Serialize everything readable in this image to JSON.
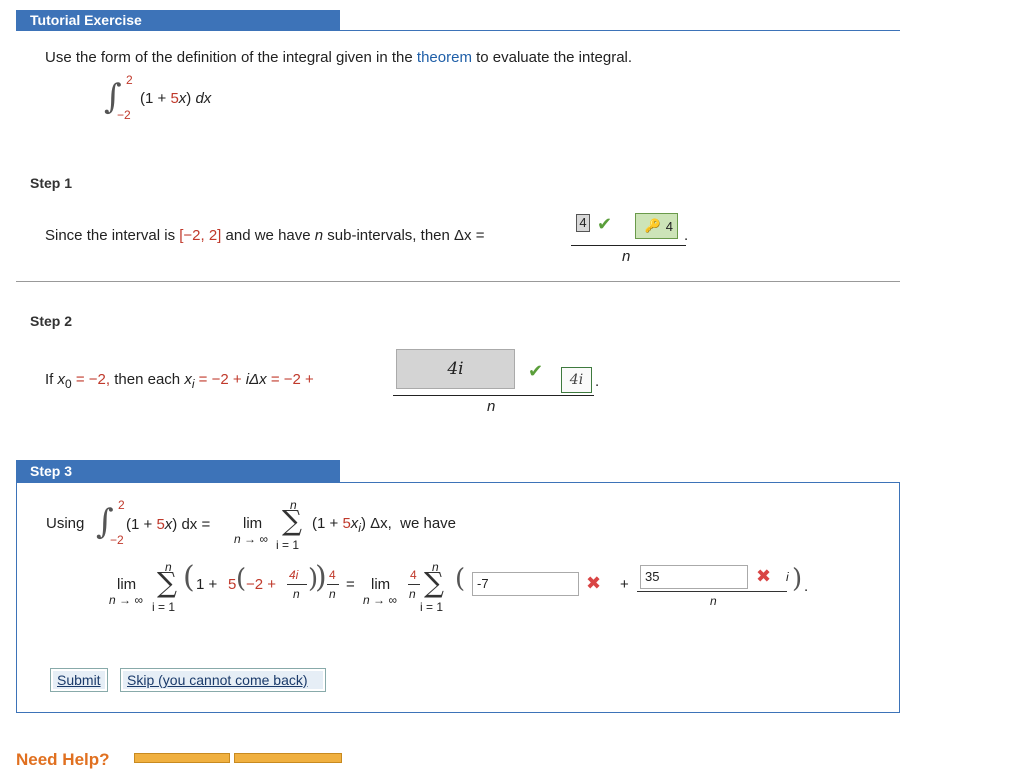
{
  "header": {
    "title": "Tutorial Exercise"
  },
  "problem": {
    "text_before_link": "Use the form of the definition of the integral given in the",
    "link_text": "theorem",
    "text_after_link": "to evaluate the integral.",
    "integral": {
      "upper": "2",
      "lower": "−2",
      "integrand_open": "(1 + ",
      "coef": "5",
      "var": "x",
      "integrand_close": ")",
      "dx": "dx"
    }
  },
  "step1": {
    "label": "Step 1",
    "text_a": "Since the interval is ",
    "interval": "[−2, 2]",
    "text_b": " and we have ",
    "n": "n",
    "text_c": " sub-intervals, then ",
    "delta_x": "Δx =",
    "answer": "4",
    "key_value": "4",
    "denominator": "n",
    "period": "."
  },
  "step2": {
    "label": "Step 2",
    "text_if": "If ",
    "x0": "x",
    "x0_sub": "0",
    "eq1": " = −2,",
    "text_then": " then each ",
    "xi": "x",
    "xi_sub": "i",
    "eq2": " = −2 + ",
    "i_delta": "iΔx",
    "eq3": " = −2 + ",
    "answer": "4i",
    "key_value": "4i",
    "denominator": "n",
    "period": "."
  },
  "step3": {
    "label": "Step 3",
    "using": "Using",
    "integral": {
      "upper": "2",
      "lower": "−2",
      "body_open": "(1 + ",
      "coef": "5",
      "var": "x",
      "body_close": ") dx ="
    },
    "lim": "lim",
    "lim_sub": "n → ∞",
    "sum_top": "n",
    "sum_bottom": "i = 1",
    "sum_body_open": "(1 + ",
    "sum_coef": "5",
    "sum_xi": "x",
    "sum_xi_sub": "i",
    "sum_body_close": ") Δx,",
    "we_have": "we have",
    "line2": {
      "lim": "lim",
      "lim_sub": "n → ∞",
      "sum_top": "n",
      "sum_bottom": "i = 1",
      "one_plus": "1 + ",
      "five": "5",
      "minus_two_plus": "−2 + ",
      "frac_num": "4i",
      "frac_den": "n",
      "outer_num": "4",
      "outer_den": "n",
      "equals": "=",
      "lim2": "lim",
      "lim2_sub": "n → ∞",
      "frac2_num": "4",
      "frac2_den": "n",
      "sum2_top": "n",
      "sum2_bottom": "i = 1",
      "input1_value": "-7",
      "plus": "+",
      "input2_value": "35",
      "input2_den": "n",
      "i_text": "i",
      "period": "."
    },
    "submit_label": "Submit",
    "skip_label": "Skip (you cannot come back)"
  },
  "footer": {
    "need_help": "Need Help?"
  },
  "colors": {
    "accent": "#3d73b8",
    "red_math": "#c0392b",
    "check": "#5a9e3a",
    "error": "#d94545"
  }
}
